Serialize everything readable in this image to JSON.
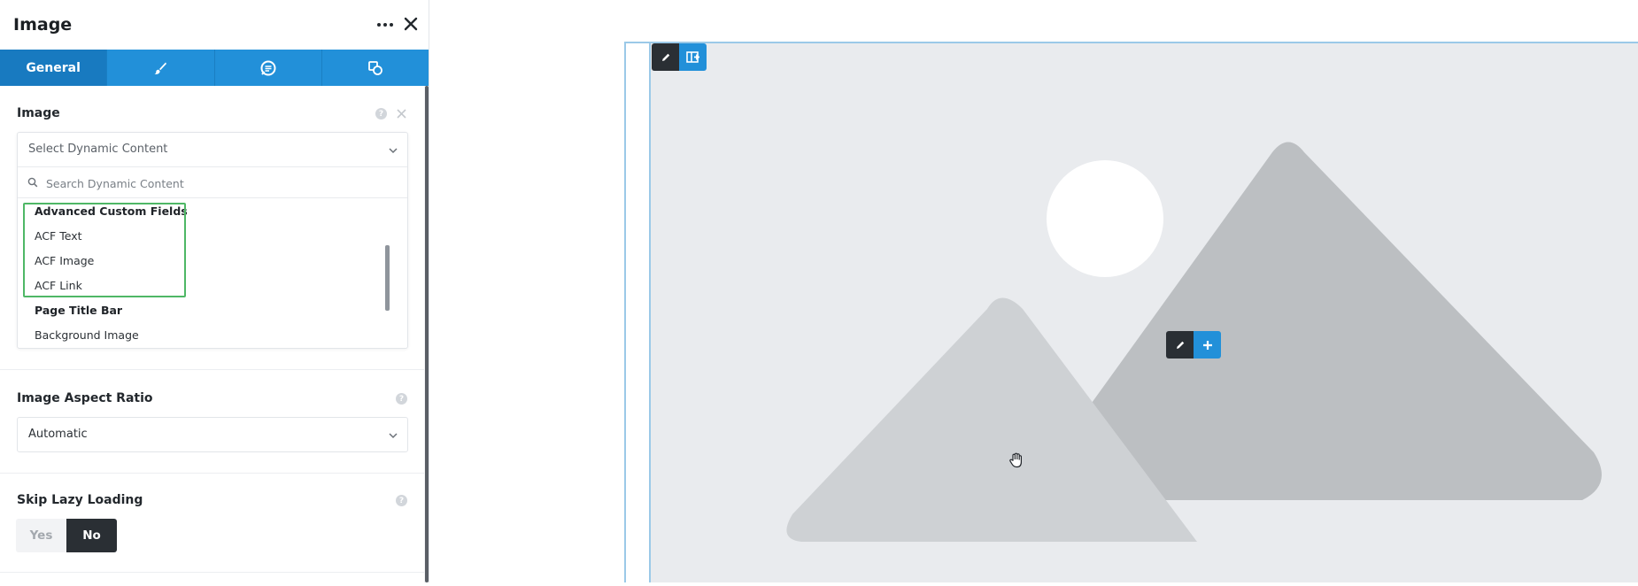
{
  "panel": {
    "title": "Image",
    "tabs": [
      {
        "label": "General",
        "icon": "general-tab",
        "active": true
      },
      {
        "label": "",
        "icon": "brush-icon",
        "active": false
      },
      {
        "label": "",
        "icon": "chat-extras-icon",
        "active": false
      },
      {
        "label": "",
        "icon": "shapes-icon",
        "active": false
      }
    ]
  },
  "image_field": {
    "label": "Image",
    "select_placeholder": "Select Dynamic Content",
    "search_placeholder": "Search Dynamic Content",
    "groups": [
      {
        "name": "Advanced Custom Fields",
        "items": [
          "ACF Text",
          "ACF Image",
          "ACF Link"
        ]
      },
      {
        "name": "Page Title Bar",
        "items": [
          "Background Image"
        ]
      }
    ]
  },
  "aspect_ratio": {
    "label": "Image Aspect Ratio",
    "value": "Automatic"
  },
  "lazy_loading": {
    "label": "Skip Lazy Loading",
    "options": [
      "Yes",
      "No"
    ],
    "selected": "No"
  },
  "colors": {
    "accent": "#2290d9",
    "tab_active": "#187ac0",
    "dark": "#2a2f34",
    "highlight": "#4fb766",
    "placeholder_bg": "#e9ebee"
  }
}
